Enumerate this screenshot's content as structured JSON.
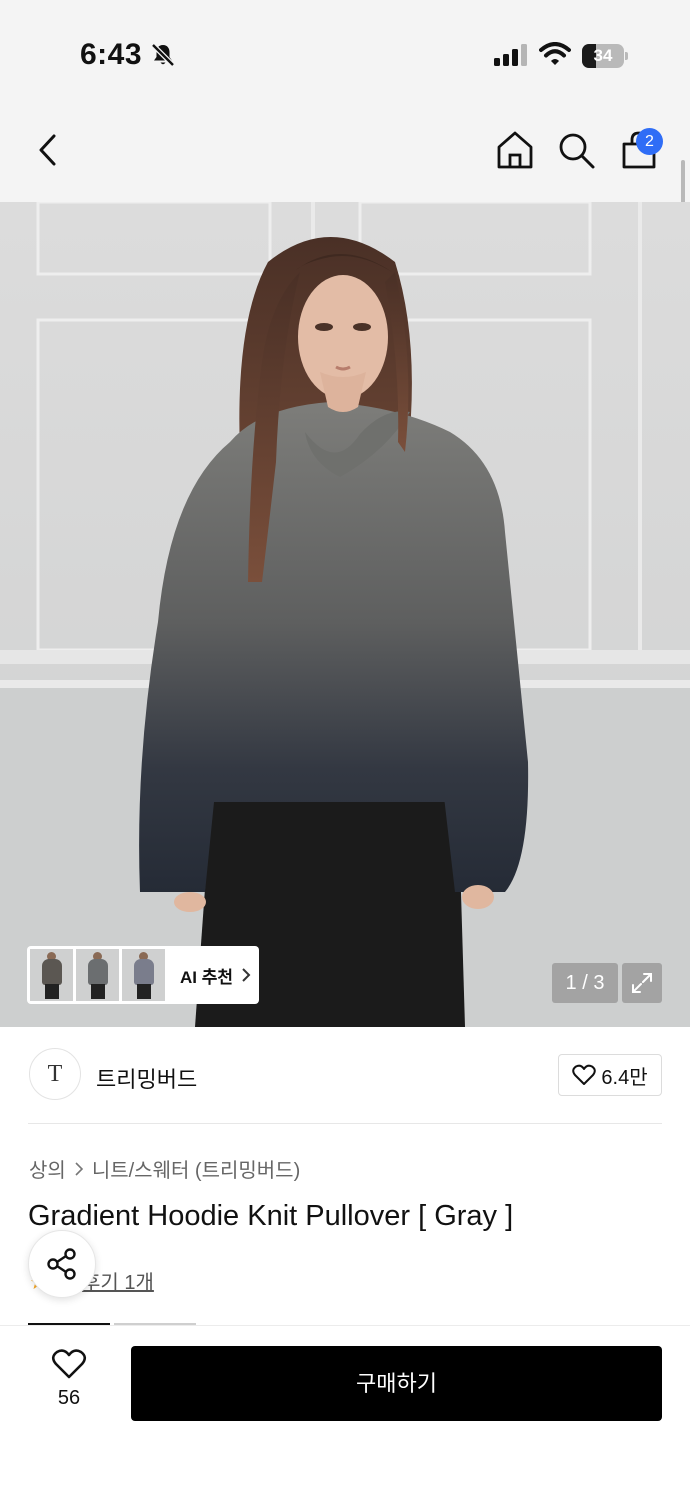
{
  "status_bar": {
    "time": "6:43",
    "battery_percent": 34,
    "battery_label": "34"
  },
  "nav": {
    "cart_count": "2"
  },
  "gallery": {
    "ai_recommend_label": "AI 추천",
    "page_counter": "1 / 3"
  },
  "brand": {
    "logo_text": "T",
    "name": "트리밍버드",
    "likes": "6.4만"
  },
  "product": {
    "breadcrumb": [
      "상의",
      "니트/스웨터 (트리밍버드)"
    ],
    "title": "Gradient Hoodie Knit Pullover [ Gray ]",
    "review_link": "후기 1개"
  },
  "bottom_bar": {
    "wish_count": "56",
    "buy_label": "구매하기"
  }
}
